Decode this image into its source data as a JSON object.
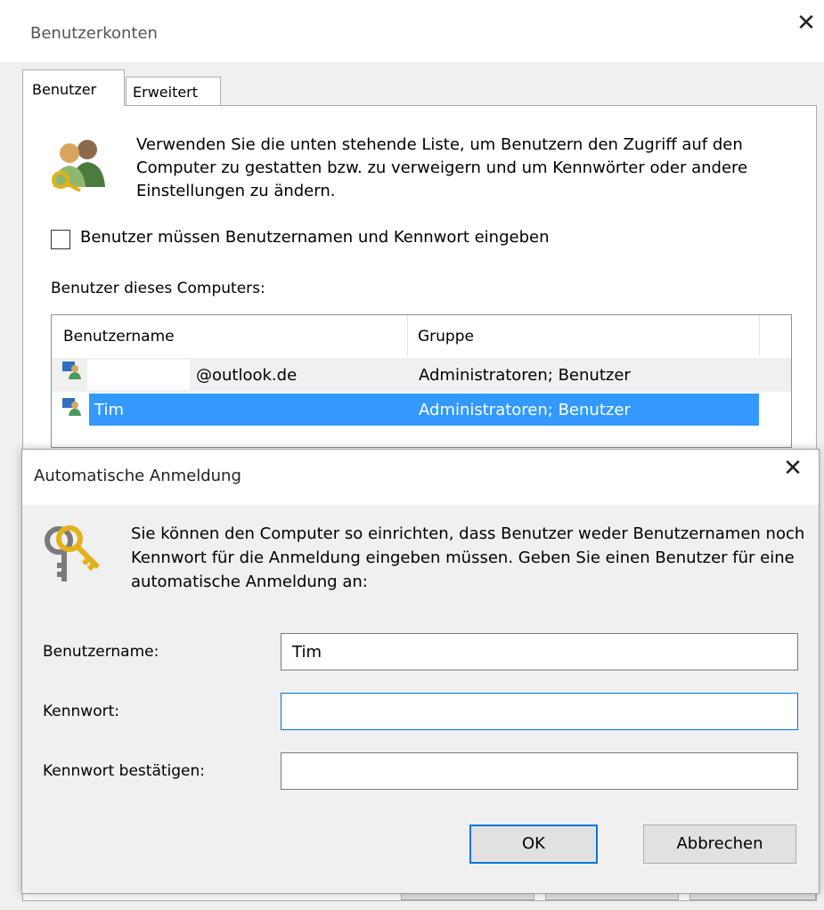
{
  "outer_window": {
    "title": "Benutzerkonten",
    "close_glyph": "✕",
    "tabs": [
      {
        "label": "Benutzer",
        "active": true
      },
      {
        "label": "Erweitert",
        "active": false
      }
    ],
    "intro_text": "Verwenden Sie die unten stehende Liste, um Benutzern den Zugriff auf den Computer zu gestatten bzw. zu verweigern und um Kennwörter oder andere Einstellungen zu ändern.",
    "require_login_checkbox": {
      "label": "Benutzer müssen Benutzernamen und Kennwort eingeben",
      "checked": false
    },
    "users_list_label": "Benutzer dieses Computers:",
    "users_table": {
      "columns": [
        "Benutzername",
        "Gruppe"
      ],
      "rows": [
        {
          "name": "@outlook.de",
          "group": "Administratoren; Benutzer",
          "selected": false
        },
        {
          "name": "Tim",
          "group": "Administratoren; Benutzer",
          "selected": true
        }
      ]
    }
  },
  "dialog": {
    "title": "Automatische Anmeldung",
    "close_glyph": "✕",
    "description": "Sie können den Computer so einrichten, dass Benutzer weder Benutzernamen noch Kennwort für die Anmeldung eingeben müssen. Geben Sie einen Benutzer für eine automatische Anmeldung an:",
    "fields": {
      "username": {
        "label": "Benutzername:",
        "value": "Tim"
      },
      "password": {
        "label": "Kennwort:",
        "value": ""
      },
      "confirm": {
        "label": "Kennwort bestätigen:",
        "value": ""
      }
    },
    "buttons": {
      "ok": "OK",
      "cancel": "Abbrechen"
    }
  },
  "colors": {
    "selection": "#3399ff",
    "focus_border": "#0078d7",
    "window_bg": "#f0f0f0"
  },
  "icons": {
    "users": "users-key-icon",
    "keys": "keys-icon",
    "user_row": "user-icon"
  }
}
